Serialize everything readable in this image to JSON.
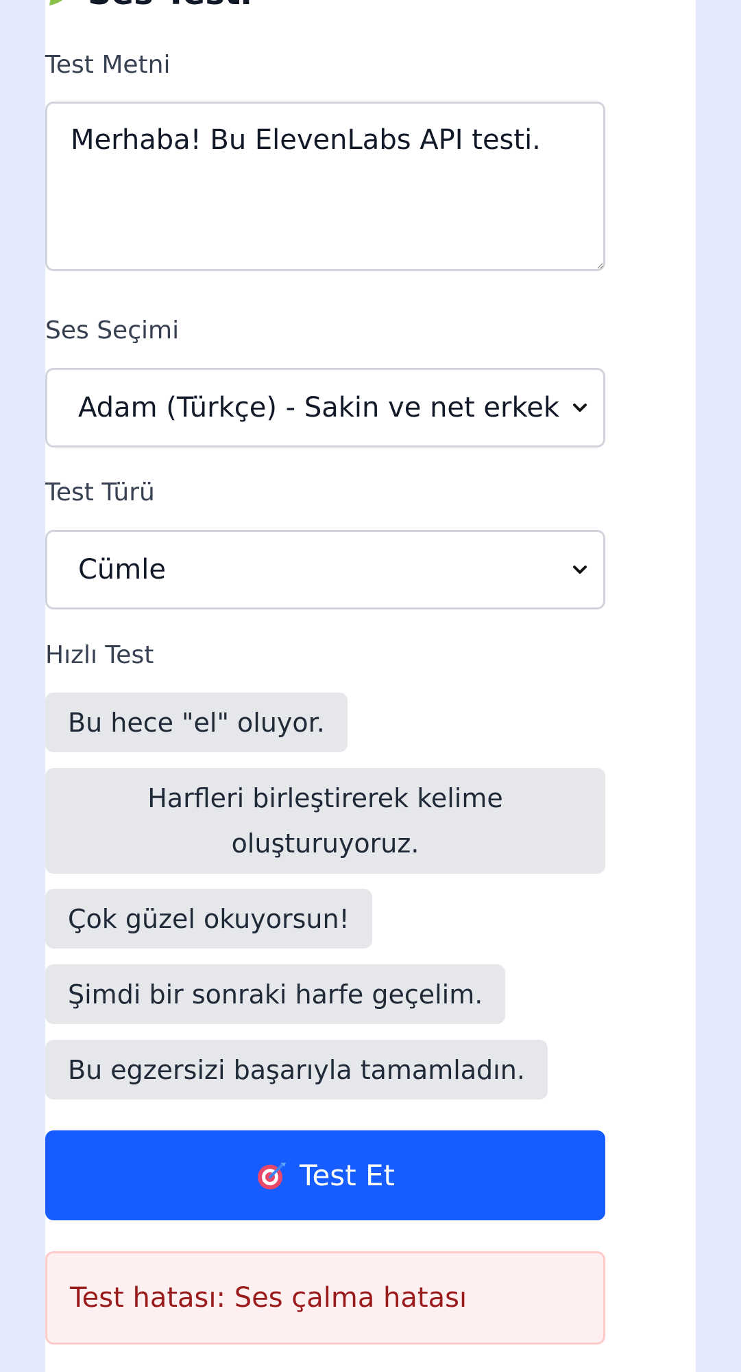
{
  "colors": {
    "page_bg": "#e4e9fb",
    "primary": "#175cff",
    "chip_bg": "#e5e7eb",
    "error_text": "#991b1b",
    "error_bg": "#fef0f0"
  },
  "header": {
    "title": "Ses Testi",
    "icon": "leaf-icon"
  },
  "form": {
    "text_label": "Test Metni",
    "text_value": "Merhaba! Bu ElevenLabs API testi.",
    "voice_label": "Ses Seçimi",
    "voice_selected": "Adam (Türkçe) - Sakin ve net erkek",
    "type_label": "Test Türü",
    "type_selected": "Cümle",
    "quick_label": "Hızlı Test",
    "quick_items": [
      "Bu hece \"el\" oluyor.",
      "Harfleri birleştirerek kelime oluşturuyoruz.",
      "Çok güzel okuyorsun!",
      "Şimdi bir sonraki harfe geçelim.",
      "Bu egzersizi başarıyla tamamladın."
    ],
    "submit_label": "Test Et",
    "submit_icon": "target-icon"
  },
  "status": {
    "error_message": "Test hatası: Ses çalma hatası"
  }
}
